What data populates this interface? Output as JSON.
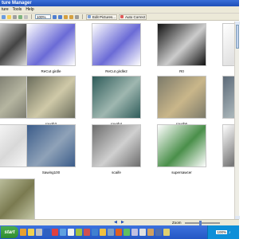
{
  "window": {
    "title": "ture Manager"
  },
  "menu": {
    "items": [
      "ture",
      "Tools",
      "Help"
    ]
  },
  "toolbar": {
    "zoom_value": "100%",
    "edit_pictures_label": "Edit Pictures...",
    "auto_correct_label": "Auto Correct"
  },
  "thumbnails": [
    {
      "label": "",
      "tone": "#ffffff",
      "accent": "#444444"
    },
    {
      "label": "ReCut girdle",
      "tone": "#ffffff",
      "accent": "#6b6bd6"
    },
    {
      "label": "ReCut girdle2",
      "tone": "#ffffff",
      "accent": "#6b6bd6"
    },
    {
      "label": "R0",
      "tone": "#111111",
      "accent": "#cccccc"
    },
    {
      "label": "",
      "tone": "#ffffff",
      "accent": "#e0e0e0"
    },
    {
      "label": "",
      "tone": "#6e6e64",
      "accent": "#b5b5a0"
    },
    {
      "label": "rough3",
      "tone": "#6b6d5c",
      "accent": "#cfc9a8"
    },
    {
      "label": "rough4",
      "tone": "#2f5c5a",
      "accent": "#9fb7b0"
    },
    {
      "label": "rough6",
      "tone": "#7c7a6a",
      "accent": "#c9b68a"
    },
    {
      "label": "",
      "tone": "#5c6a78",
      "accent": "#a8b4b8"
    },
    {
      "label": "",
      "tone": "#ffffff",
      "accent": "#d8d8d8"
    },
    {
      "label": "Sawing100",
      "tone": "#3b5c8a",
      "accent": "#8fa2b8"
    },
    {
      "label": "scaife",
      "tone": "#6c6c6c",
      "accent": "#d0d0d0"
    },
    {
      "label": "supersawcer",
      "tone": "#ffffff",
      "accent": "#4a8f4a"
    },
    {
      "label": "",
      "tone": "#ffffff",
      "accent": "#777777"
    },
    {
      "label": "",
      "tone": "#d0d4b4",
      "accent": "#7a7a50"
    }
  ],
  "status": {
    "zoom_label": "Zoom"
  },
  "taskbar": {
    "start_label": "start",
    "tray_percent": "100%"
  }
}
